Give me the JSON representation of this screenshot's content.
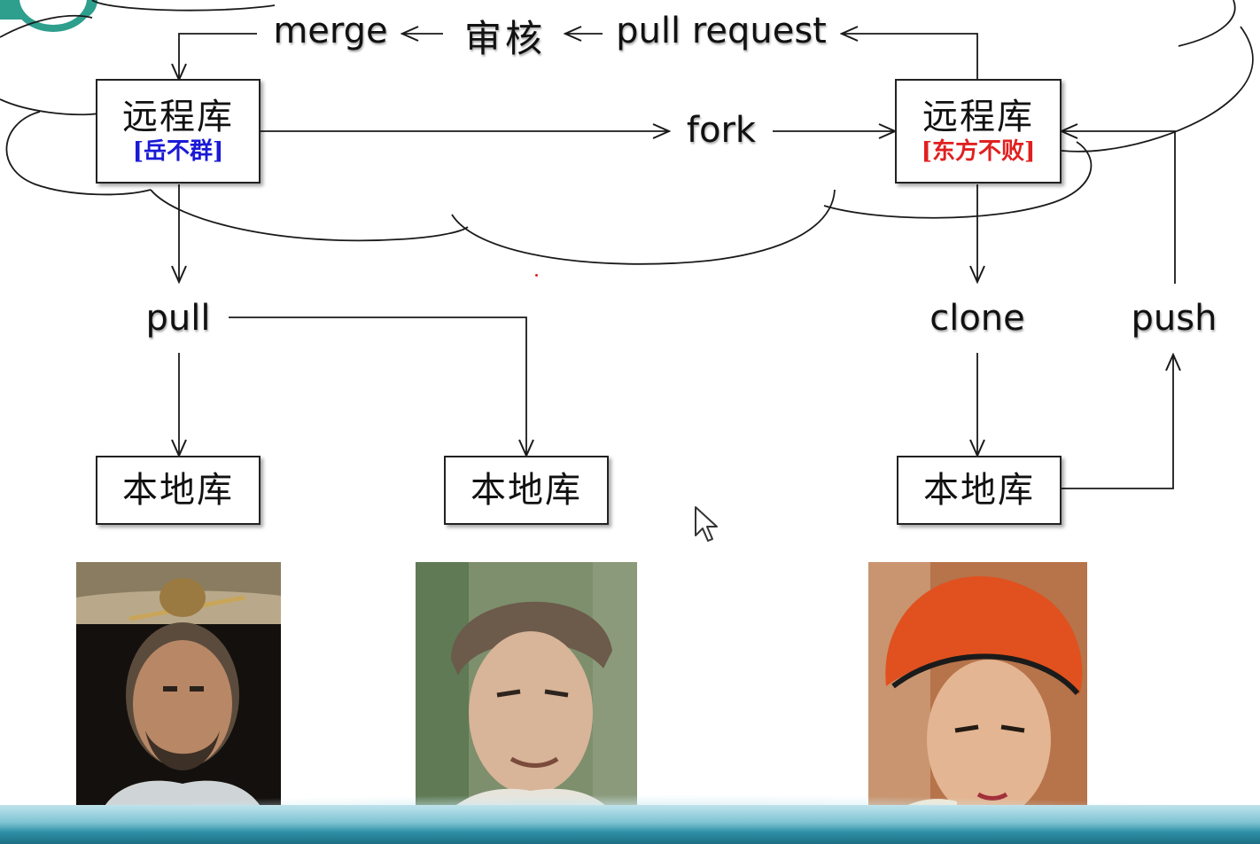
{
  "arrows": {
    "merge": "merge",
    "review": "审核",
    "pull_request": "pull request",
    "fork": "fork",
    "pull": "pull",
    "clone": "clone",
    "push": "push"
  },
  "remote_repos": [
    {
      "title": "远程库",
      "owner": "[岳不群]",
      "owner_color": "#1a1ad6"
    },
    {
      "title": "远程库",
      "owner": "[东方不败]",
      "owner_color": "#e02020"
    }
  ],
  "local_repos": [
    {
      "title": "本地库"
    },
    {
      "title": "本地库"
    },
    {
      "title": "本地库"
    }
  ],
  "colors": {
    "line": "#1a1a1a",
    "frame_accent": "#2e9f8d",
    "bottom_strip": "#2e8fa6"
  },
  "portraits": [
    {
      "icon": "portrait-elder-man-with-beard"
    },
    {
      "icon": "portrait-young-man-looking-up"
    },
    {
      "icon": "portrait-woman-red-hat"
    }
  ]
}
